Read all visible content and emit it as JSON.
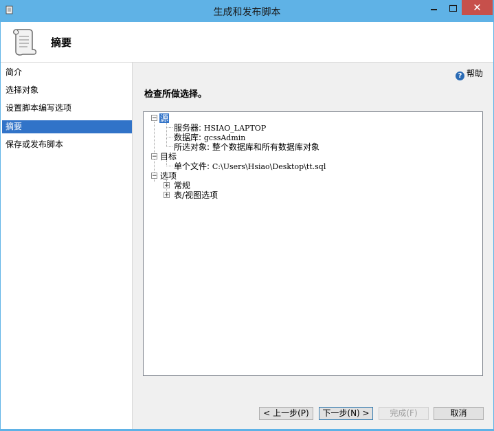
{
  "window": {
    "title": "生成和发布脚本",
    "close_label": "✕"
  },
  "header": {
    "heading": "摘要"
  },
  "nav": {
    "items": [
      {
        "label": "简介"
      },
      {
        "label": "选择对象"
      },
      {
        "label": "设置脚本编写选项"
      },
      {
        "label": "摘要",
        "selected": true
      },
      {
        "label": "保存或发布脚本"
      }
    ]
  },
  "main": {
    "help_label": "帮助",
    "review_title": "检查所做选择。",
    "tree": {
      "source": {
        "label": "源",
        "server_label": "服务器:",
        "server_value": "HSIAO_LAPTOP",
        "database_label": "数据库:",
        "database_value": "gcssAdmin",
        "objects_label": "所选对象:",
        "objects_value": "整个数据库和所有数据库对象"
      },
      "target": {
        "label": "目标",
        "file_label": "单个文件:",
        "file_value": "C:\\Users\\Hsiao\\Desktop\\tt.sql"
      },
      "options": {
        "label": "选项",
        "general_label": "常规",
        "table_view_label": "表/视图选项"
      }
    }
  },
  "footer": {
    "prev_label": "< 上一步(P)",
    "next_label": "下一步(N) >",
    "finish_label": "完成(F)",
    "cancel_label": "取消"
  },
  "colors": {
    "title_bar": "#5fb2e6",
    "selection": "#3173c8",
    "close_button": "#c7504b"
  }
}
